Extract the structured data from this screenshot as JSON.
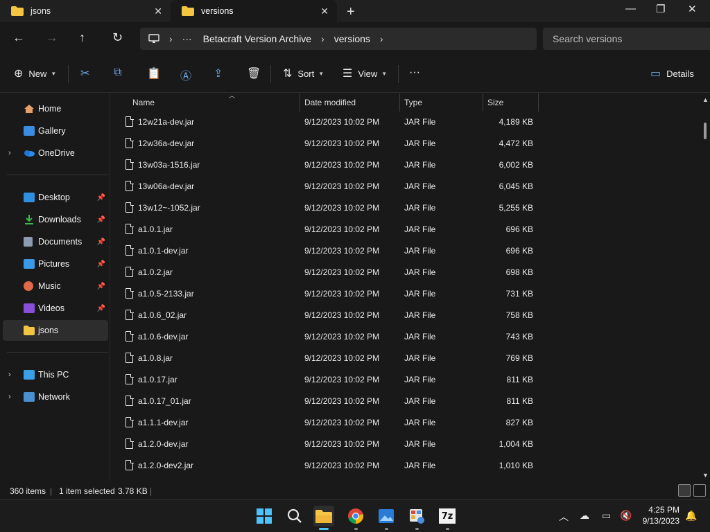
{
  "tabs": [
    {
      "label": "jsons",
      "active": false
    },
    {
      "label": "versions",
      "active": true
    }
  ],
  "address": {
    "more": "···",
    "segments": [
      "Betacraft Version Archive",
      "versions"
    ]
  },
  "search": {
    "placeholder": "Search versions"
  },
  "toolbar": {
    "new_label": "New",
    "sort_label": "Sort",
    "view_label": "View",
    "more_label": "···",
    "details_label": "Details"
  },
  "sidebar": {
    "items": [
      {
        "label": "Home",
        "icon": "home-icon"
      },
      {
        "label": "Gallery",
        "icon": "gallery-icon"
      },
      {
        "label": "OneDrive",
        "icon": "onedrive-icon"
      },
      {
        "label": "Desktop",
        "icon": "desktop-icon"
      },
      {
        "label": "Downloads",
        "icon": "downloads-icon"
      },
      {
        "label": "Documents",
        "icon": "documents-icon"
      },
      {
        "label": "Pictures",
        "icon": "pictures-icon"
      },
      {
        "label": "Music",
        "icon": "music-icon"
      },
      {
        "label": "Videos",
        "icon": "videos-icon"
      },
      {
        "label": "jsons",
        "icon": "folder-icon"
      },
      {
        "label": "This PC",
        "icon": "pc-icon"
      },
      {
        "label": "Network",
        "icon": "network-icon"
      }
    ]
  },
  "columns": {
    "name": "Name",
    "date": "Date modified",
    "type": "Type",
    "size": "Size"
  },
  "files": [
    {
      "name": "12w21a-dev.jar",
      "date": "9/12/2023 10:02 PM",
      "type": "JAR File",
      "size": "4,189 KB"
    },
    {
      "name": "12w36a-dev.jar",
      "date": "9/12/2023 10:02 PM",
      "type": "JAR File",
      "size": "4,472 KB"
    },
    {
      "name": "13w03a-1516.jar",
      "date": "9/12/2023 10:02 PM",
      "type": "JAR File",
      "size": "6,002 KB"
    },
    {
      "name": "13w06a-dev.jar",
      "date": "9/12/2023 10:02 PM",
      "type": "JAR File",
      "size": "6,045 KB"
    },
    {
      "name": "13w12~-1052.jar",
      "date": "9/12/2023 10:02 PM",
      "type": "JAR File",
      "size": "5,255 KB"
    },
    {
      "name": "a1.0.1.jar",
      "date": "9/12/2023 10:02 PM",
      "type": "JAR File",
      "size": "696 KB"
    },
    {
      "name": "a1.0.1-dev.jar",
      "date": "9/12/2023 10:02 PM",
      "type": "JAR File",
      "size": "696 KB"
    },
    {
      "name": "a1.0.2.jar",
      "date": "9/12/2023 10:02 PM",
      "type": "JAR File",
      "size": "698 KB"
    },
    {
      "name": "a1.0.5-2133.jar",
      "date": "9/12/2023 10:02 PM",
      "type": "JAR File",
      "size": "731 KB"
    },
    {
      "name": "a1.0.6_02.jar",
      "date": "9/12/2023 10:02 PM",
      "type": "JAR File",
      "size": "758 KB"
    },
    {
      "name": "a1.0.6-dev.jar",
      "date": "9/12/2023 10:02 PM",
      "type": "JAR File",
      "size": "743 KB"
    },
    {
      "name": "a1.0.8.jar",
      "date": "9/12/2023 10:02 PM",
      "type": "JAR File",
      "size": "769 KB"
    },
    {
      "name": "a1.0.17.jar",
      "date": "9/12/2023 10:02 PM",
      "type": "JAR File",
      "size": "811 KB"
    },
    {
      "name": "a1.0.17_01.jar",
      "date": "9/12/2023 10:02 PM",
      "type": "JAR File",
      "size": "811 KB"
    },
    {
      "name": "a1.1.1-dev.jar",
      "date": "9/12/2023 10:02 PM",
      "type": "JAR File",
      "size": "827 KB"
    },
    {
      "name": "a1.2.0-dev.jar",
      "date": "9/12/2023 10:02 PM",
      "type": "JAR File",
      "size": "1,004 KB"
    },
    {
      "name": "a1.2.0-dev2.jar",
      "date": "9/12/2023 10:02 PM",
      "type": "JAR File",
      "size": "1,010 KB"
    }
  ],
  "status": {
    "item_count": "360 items",
    "selection": "1 item selected",
    "selection_size": "3.78 KB"
  },
  "taskbar": {
    "apps": [
      "windows-start-icon",
      "search-icon",
      "file-explorer-icon",
      "chrome-icon",
      "photos-icon",
      "settings-app-icon",
      "7zip-icon"
    ],
    "sevenzip_label": "7z",
    "time": "4:25 PM",
    "date": "9/13/2023"
  },
  "colors": {
    "folder": "#f4c542",
    "accent": "#4cc2ff",
    "background": "#191919"
  }
}
